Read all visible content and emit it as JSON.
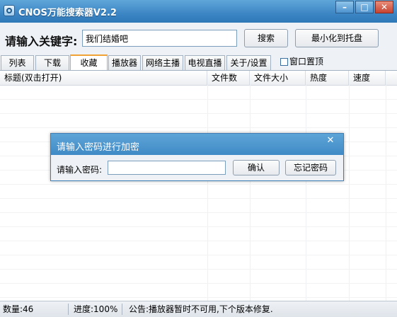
{
  "window": {
    "title": "CNOS万能搜索器V2.2",
    "min_glyph": "–",
    "max_glyph": "□",
    "close_glyph": "✕"
  },
  "toolbar": {
    "keyword_label": "请输入关键字:",
    "keyword_value": "我们结婚吧",
    "search_button": "搜索",
    "tray_button": "最小化到托盘"
  },
  "tabs": [
    {
      "label": "列表",
      "active": false
    },
    {
      "label": "下载",
      "active": false
    },
    {
      "label": "收藏",
      "active": true
    },
    {
      "label": "播放器",
      "active": false
    },
    {
      "label": "网络主播",
      "active": false
    },
    {
      "label": "电视直播",
      "active": false
    },
    {
      "label": "关于/设置",
      "active": false
    }
  ],
  "always_on_top": {
    "label": "窗口置顶",
    "checked": false
  },
  "list": {
    "columns": [
      "标题(双击打开)",
      "文件数",
      "文件大小",
      "热度",
      "速度"
    ]
  },
  "dialog": {
    "title": "请输入密码进行加密",
    "close_glyph": "✕",
    "password_label": "请输入密码:",
    "password_value": "",
    "ok_button": "确认",
    "forgot_button": "忘记密码"
  },
  "status": {
    "count": "数量:46",
    "progress": "进度:100%",
    "notice": "公告:播放器暂时不可用,下个版本修复."
  },
  "colors": {
    "titlebar": "#3d86c4",
    "active_tab_accent": "#f0a234"
  }
}
